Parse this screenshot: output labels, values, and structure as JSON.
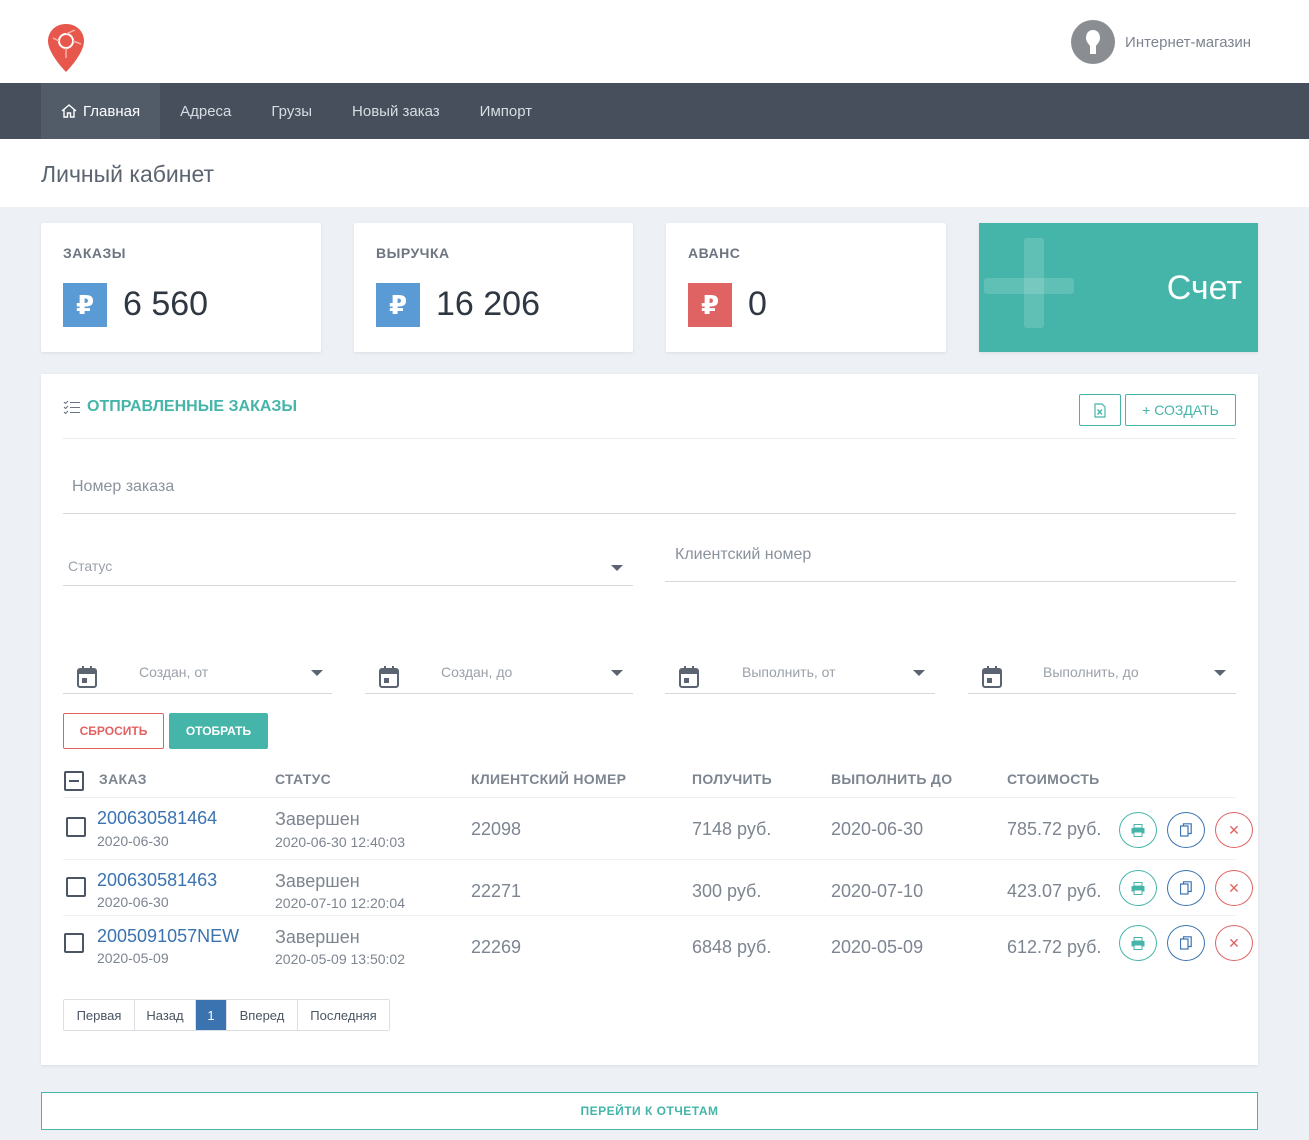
{
  "header": {
    "user_name": "Интернет-магазин"
  },
  "nav": {
    "items": [
      {
        "label": "Главная"
      },
      {
        "label": "Адреса"
      },
      {
        "label": "Грузы"
      },
      {
        "label": "Новый заказ"
      },
      {
        "label": "Импорт"
      }
    ]
  },
  "page": {
    "title": "Личный кабинет"
  },
  "stats": {
    "orders": {
      "label": "ЗАКАЗЫ",
      "value": "6 560",
      "symbol": "₽",
      "color": "#5b9bd5"
    },
    "revenue": {
      "label": "ВЫРУЧКА",
      "value": "16 206",
      "symbol": "₽",
      "color": "#5b9bd5"
    },
    "advance": {
      "label": "АВАНС",
      "value": "0",
      "symbol": "₽",
      "color": "#e06363"
    },
    "invoice": {
      "label": "Счет",
      "color": "#45b5a9"
    }
  },
  "orders_panel": {
    "title": "ОТПРАВЛЕННЫЕ ЗАКАЗЫ",
    "create_label": "+ СОЗДАТЬ",
    "filters": {
      "order_number_placeholder": "Номер заказа",
      "status_placeholder": "Статус",
      "client_number_placeholder": "Клиентский номер",
      "created_from": "Создан, от",
      "created_to": "Создан, до",
      "due_from": "Выполнить, от",
      "due_to": "Выполнить, до"
    },
    "reset_label": "СБРОСИТЬ",
    "apply_label": "ОТОБРАТЬ",
    "columns": [
      "ЗАКАЗ",
      "СТАТУС",
      "КЛИЕНТСКИЙ НОМЕР",
      "ПОЛУЧИТЬ",
      "ВЫПОЛНИТЬ ДО",
      "СТОИМОСТЬ"
    ],
    "rows": [
      {
        "order": "200630581464",
        "date": "2020-06-30",
        "status": "Завершен",
        "status_time": "2020-06-30 12:40:03",
        "client_number": "22098",
        "receive": "7148 руб.",
        "due": "2020-06-30",
        "cost": "785.72 руб."
      },
      {
        "order": "200630581463",
        "date": "2020-06-30",
        "status": "Завершен",
        "status_time": "2020-07-10 12:20:04",
        "client_number": "22271",
        "receive": "300 руб.",
        "due": "2020-07-10",
        "cost": "423.07 руб."
      },
      {
        "order": "2005091057NEW",
        "date": "2020-05-09",
        "status": "Завершен",
        "status_time": "2020-05-09 13:50:02",
        "client_number": "22269",
        "receive": "6848 руб.",
        "due": "2020-05-09",
        "cost": "612.72 руб."
      }
    ],
    "pagination": {
      "first": "Первая",
      "prev": "Назад",
      "current": "1",
      "next": "Вперед",
      "last": "Последняя"
    }
  },
  "reports_label": "ПЕРЕЙТИ К ОТЧЕТАМ",
  "colors": {
    "accent": "#45b5a9",
    "nav_bg": "#464f5b",
    "link": "#3a73b0",
    "danger": "#e06363"
  }
}
